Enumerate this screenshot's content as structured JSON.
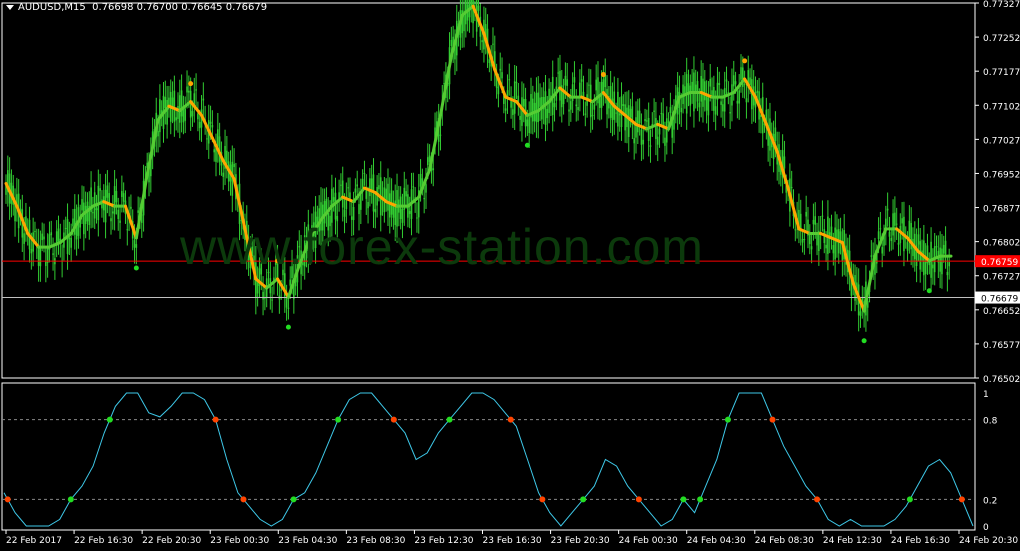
{
  "header": {
    "symbol_timeframe": "AUDUSD,M15",
    "ohlc": "0.76698 0.76700 0.76645 0.76679"
  },
  "watermark": "www.forex-station.com",
  "colors": {
    "background": "#000000",
    "candles": "#32cd32",
    "ma_up": "#55cc33",
    "ma_down": "#ffa500",
    "oscillator": "#3ec8e8",
    "dot_buy": "#22dd22",
    "dot_sell": "#ff4400",
    "level_red": "#ff0000",
    "level_gray": "#c0c0c0",
    "axis": "#ffffff"
  },
  "chart_data": [
    {
      "type": "line",
      "title": "AUDUSD,M15",
      "y_ticks": [
        "0.77327",
        "0.77252",
        "0.77177",
        "0.77102",
        "0.77027",
        "0.76952",
        "0.76877",
        "0.76802",
        "0.76727",
        "0.76652",
        "0.76577",
        "0.76502"
      ],
      "ylim": [
        0.76502,
        0.77327
      ],
      "price_labels": {
        "red_line": "0.76759",
        "gray_line": "0.76679"
      },
      "series": [
        {
          "values": [
            0.7693,
            0.7688,
            0.7682,
            0.7679,
            0.7679,
            0.768,
            0.7682,
            0.7686,
            0.7688,
            0.7689,
            0.7688,
            0.7688,
            0.7681,
            0.7695,
            0.7707,
            0.771,
            0.7709,
            0.7711,
            0.7708,
            0.7703,
            0.7698,
            0.7694,
            0.7683,
            0.7672,
            0.767,
            0.7672,
            0.7668,
            0.7675,
            0.7681,
            0.7685,
            0.7688,
            0.769,
            0.7689,
            0.7692,
            0.7691,
            0.7689,
            0.7688,
            0.7688,
            0.769,
            0.7696,
            0.7708,
            0.7721,
            0.773,
            0.7732,
            0.7726,
            0.7718,
            0.7712,
            0.7711,
            0.7708,
            0.7709,
            0.7711,
            0.7714,
            0.7712,
            0.7712,
            0.7711,
            0.7713,
            0.771,
            0.7708,
            0.7706,
            0.7705,
            0.7706,
            0.7705,
            0.7712,
            0.7713,
            0.7713,
            0.7712,
            0.7712,
            0.7713,
            0.7716,
            0.7712,
            0.7706,
            0.77,
            0.7692,
            0.7683,
            0.7682,
            0.7682,
            0.7681,
            0.768,
            0.7671,
            0.7665,
            0.7677,
            0.7683,
            0.7683,
            0.7681,
            0.7678,
            0.7676,
            0.7677,
            0.7677
          ]
        }
      ]
    },
    {
      "type": "line",
      "y_ticks": [
        "1",
        "0.8",
        "0.2",
        "0"
      ],
      "ylim": [
        0,
        1
      ],
      "levels": [
        0.8,
        0.2
      ],
      "series": [
        {
          "values": [
            0.25,
            0.1,
            0.0,
            0.0,
            0.0,
            0.05,
            0.2,
            0.3,
            0.45,
            0.7,
            0.9,
            1.0,
            1.0,
            0.85,
            0.82,
            0.9,
            1.0,
            1.0,
            0.95,
            0.8,
            0.5,
            0.25,
            0.15,
            0.05,
            0.0,
            0.05,
            0.2,
            0.25,
            0.4,
            0.6,
            0.8,
            0.95,
            1.0,
            1.0,
            0.9,
            0.8,
            0.7,
            0.5,
            0.55,
            0.7,
            0.8,
            0.9,
            1.0,
            1.0,
            0.95,
            0.85,
            0.75,
            0.5,
            0.25,
            0.1,
            0.0,
            0.1,
            0.2,
            0.3,
            0.5,
            0.45,
            0.3,
            0.2,
            0.1,
            0.0,
            0.05,
            0.2,
            0.1,
            0.3,
            0.5,
            0.8,
            1.0,
            1.0,
            1.0,
            0.8,
            0.6,
            0.45,
            0.3,
            0.2,
            0.05,
            0.0,
            0.05,
            0.0,
            0.0,
            0.0,
            0.05,
            0.15,
            0.3,
            0.45,
            0.5,
            0.4,
            0.2,
            0.0
          ]
        }
      ]
    }
  ],
  "x_axis_labels": [
    "22 Feb 2017",
    "22 Feb 16:30",
    "22 Feb 20:30",
    "23 Feb 00:30",
    "23 Feb 04:30",
    "23 Feb 08:30",
    "23 Feb 12:30",
    "23 Feb 16:30",
    "23 Feb 20:30",
    "24 Feb 00:30",
    "24 Feb 04:30",
    "24 Feb 08:30",
    "24 Feb 12:30",
    "24 Feb 16:30",
    "24 Feb 20:30"
  ]
}
